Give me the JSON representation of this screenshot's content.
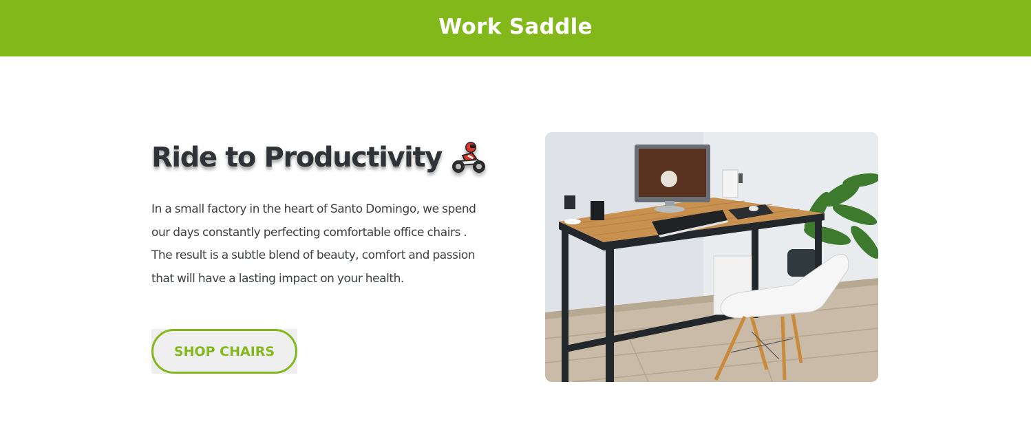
{
  "header": {
    "brand": "Work Saddle",
    "background": "#82b81a"
  },
  "hero": {
    "title": "Ride to Productivity",
    "title_icon": "motorcycle-rider-icon",
    "description": "In a small factory in the heart of Santo Domingo, we spend our days constantly perfecting comfortable office chairs . The result is a subtle blend of beauty, comfort and passion that will have a lasting impact on your health.",
    "cta_label": "SHOP CHAIRS",
    "accent": "#82b81a",
    "image_subject": "wooden desk with monitor, keyboard, white chair and plant"
  }
}
